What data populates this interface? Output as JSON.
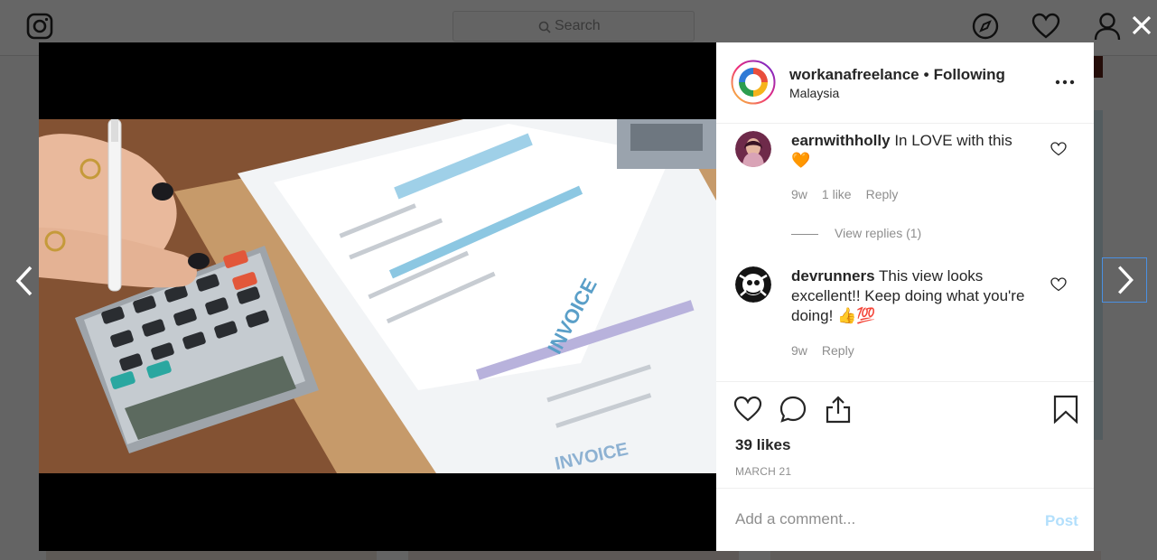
{
  "topbar": {
    "logo_icon": "instagram-icon",
    "search_placeholder": "Search",
    "icons": [
      "explore-compass-icon",
      "activity-heart-icon",
      "profile-icon"
    ]
  },
  "post": {
    "author": {
      "username": "workanafreelance",
      "separator": "•",
      "follow_status": "Following",
      "location": "Malaysia"
    },
    "image_subject": "hand with pen on calculator beside paper invoices",
    "comments": [
      {
        "username": "earnwithholly",
        "text": "In LOVE with this",
        "emoji": "🧡",
        "time": "9w",
        "likes_label": "1 like",
        "reply_label": "Reply",
        "view_replies_label": "View replies (1)"
      },
      {
        "username": "devrunners",
        "text": "This view looks excellent!! Keep doing what you're doing!",
        "emoji": "👍💯",
        "time": "9w",
        "reply_label": "Reply"
      }
    ],
    "likes": "39 likes",
    "date": "MARCH 21",
    "comment_placeholder": "Add a comment...",
    "post_label": "Post"
  },
  "colors": {
    "link_disabled": "#b2dffc",
    "secondary_text": "#8e8e8e",
    "primary_text": "#262626",
    "highlight_border": "#4a90e2"
  }
}
